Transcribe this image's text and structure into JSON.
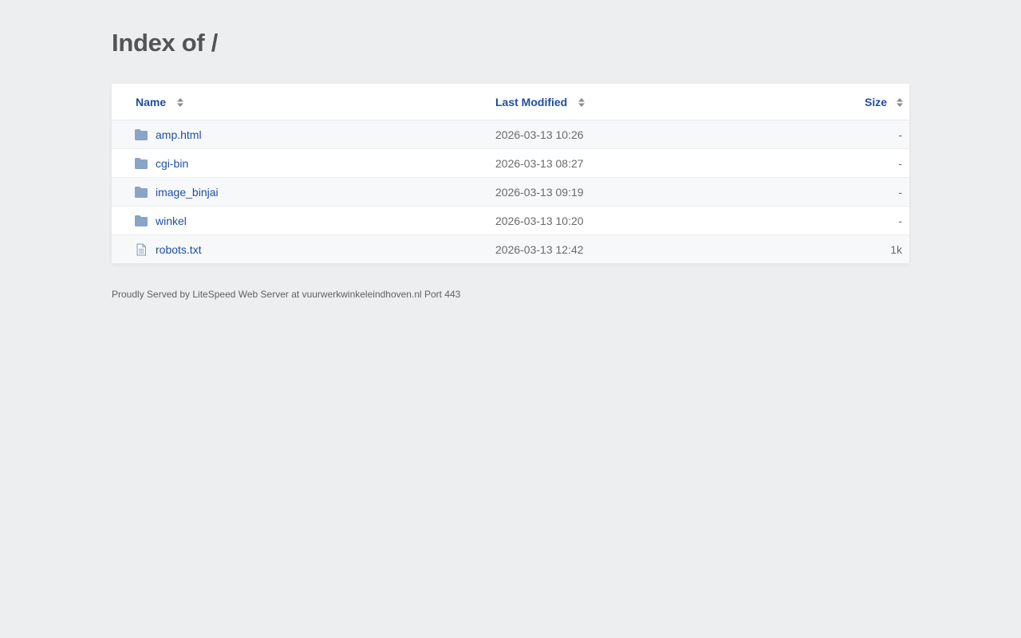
{
  "page": {
    "title": "Index of /"
  },
  "table": {
    "headers": {
      "name": "Name",
      "last_modified": "Last Modified",
      "size": "Size"
    },
    "rows": [
      {
        "name": "amp.html",
        "type": "folder",
        "modified": "2026-03-13 10:26",
        "size": "-"
      },
      {
        "name": "cgi-bin",
        "type": "folder",
        "modified": "2026-03-13 08:27",
        "size": "-"
      },
      {
        "name": "image_binjai",
        "type": "folder",
        "modified": "2026-03-13 09:19",
        "size": "-"
      },
      {
        "name": "winkel",
        "type": "folder",
        "modified": "2026-03-13 10:20",
        "size": "-"
      },
      {
        "name": "robots.txt",
        "type": "file",
        "modified": "2026-03-13 12:42",
        "size": "1k"
      }
    ]
  },
  "footer": {
    "text": "Proudly Served by LiteSpeed Web Server at vuurwerkwinkeleindhoven.nl Port 443"
  },
  "colors": {
    "background": "#edeef0",
    "link": "#1d4fa0",
    "folder_icon": "#8aa4c8",
    "title": "#545454"
  },
  "icons": {
    "folder": "folder-icon",
    "file": "file-icon",
    "sort": "sort-icon"
  }
}
